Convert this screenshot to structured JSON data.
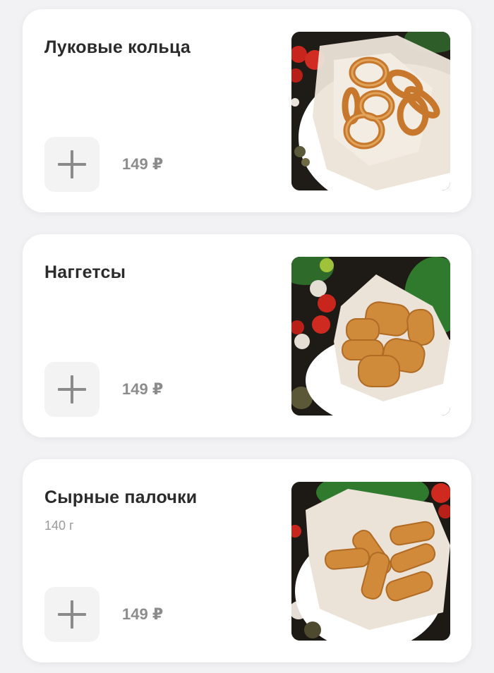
{
  "menu": {
    "items": [
      {
        "title": "Луковые кольца",
        "weight": "",
        "price": "149 ₽",
        "photo_icon": "onion-rings-photo"
      },
      {
        "title": "Наггетсы",
        "weight": "",
        "price": "149 ₽",
        "photo_icon": "nuggets-photo"
      },
      {
        "title": "Сырные палочки",
        "weight": "140 г",
        "price": "149 ₽",
        "photo_icon": "cheese-sticks-photo"
      }
    ]
  },
  "colors": {
    "background": "#f2f2f4",
    "card": "#ffffff",
    "title": "#2b2b2b",
    "price": "#8c8c8c",
    "add_button_bg": "#f3f3f3",
    "plus_icon": "#8a8a8a"
  }
}
